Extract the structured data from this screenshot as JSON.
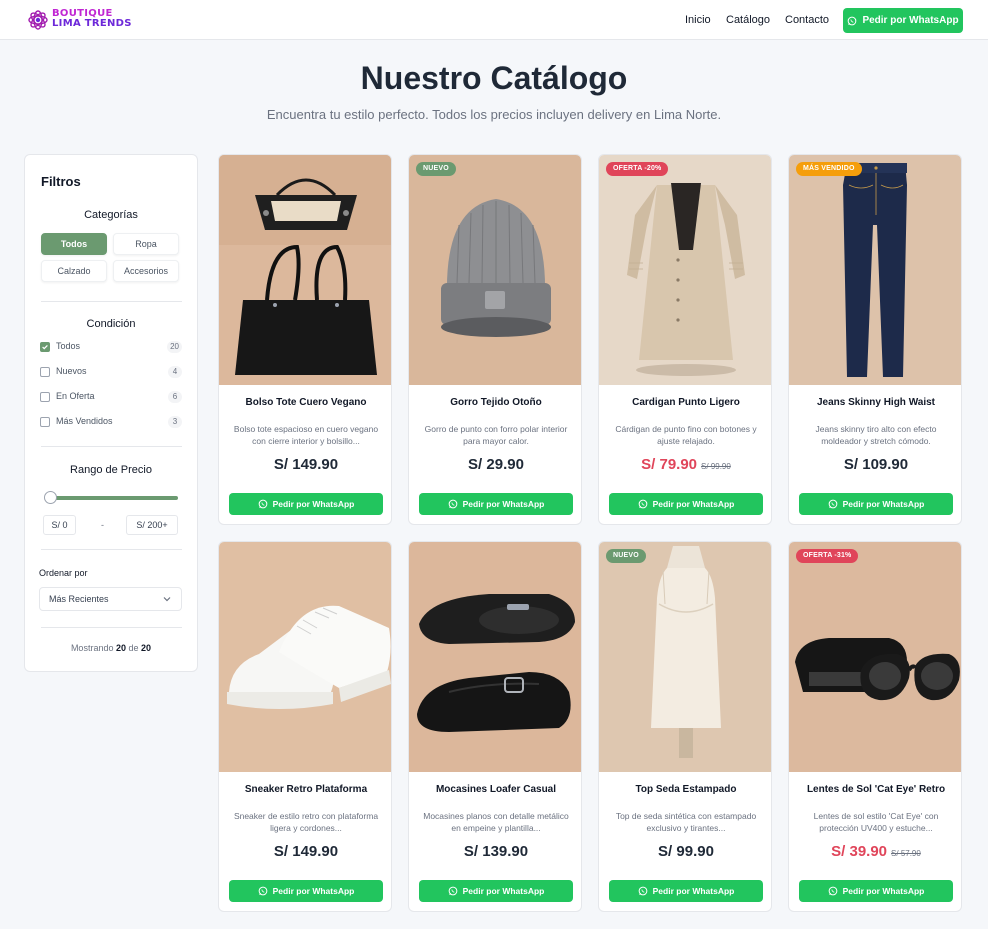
{
  "brand": {
    "line1": "BOUTIQUE",
    "line2": "LIMA TRENDS"
  },
  "nav": {
    "links": [
      "Inicio",
      "Catálogo",
      "Contacto"
    ],
    "whatsapp_label": "Pedir por WhatsApp"
  },
  "hero": {
    "title": "Nuestro Catálogo",
    "subtitle": "Encuentra tu estilo perfecto. Todos los precios incluyen delivery en Lima Norte."
  },
  "filters": {
    "title": "Filtros",
    "categories_title": "Categorías",
    "categories": [
      "Todos",
      "Ropa",
      "Calzado",
      "Accesorios"
    ],
    "active_category": "Todos",
    "condition_title": "Condición",
    "conditions": [
      {
        "label": "Todos",
        "count": "20",
        "checked": true
      },
      {
        "label": "Nuevos",
        "count": "4",
        "checked": false
      },
      {
        "label": "En Oferta",
        "count": "6",
        "checked": false
      },
      {
        "label": "Más Vendidos",
        "count": "3",
        "checked": false
      }
    ],
    "price_title": "Rango de Precio",
    "price_min": "S/ 0",
    "price_sep": "-",
    "price_max": "S/ 200+",
    "sort_label": "Ordenar por",
    "sort_value": "Más Recientes",
    "showing_prefix": "Mostrando",
    "showing_count": "20",
    "showing_mid": "de",
    "showing_total": "20"
  },
  "products": [
    {
      "name": "Bolso Tote Cuero Vegano",
      "desc": "Bolso tote espacioso en cuero vegano con cierre interior y bolsillo...",
      "price": "S/ 149.90",
      "old_price": "",
      "badge": "",
      "button": "Pedir por WhatsApp"
    },
    {
      "name": "Gorro Tejido Otoño",
      "desc": "Gorro de punto con forro polar interior para mayor calor.",
      "price": "S/ 29.90",
      "old_price": "",
      "badge": "NUEVO",
      "button": "Pedir por WhatsApp"
    },
    {
      "name": "Cardigan Punto Ligero",
      "desc": "Cárdigan de punto fino con botones y ajuste relajado.",
      "price": "S/ 79.90",
      "old_price": "S/ 99.90",
      "badge": "OFERTA -20%",
      "button": "Pedir por WhatsApp"
    },
    {
      "name": "Jeans Skinny High Waist",
      "desc": "Jeans skinny tiro alto con efecto moldeador y stretch cómodo.",
      "price": "S/ 109.90",
      "old_price": "",
      "badge": "MÁS VENDIDO",
      "button": "Pedir por WhatsApp"
    },
    {
      "name": "Sneaker Retro Plataforma",
      "desc": "Sneaker de estilo retro con plataforma ligera y cordones...",
      "price": "S/ 149.90",
      "old_price": "",
      "badge": "",
      "button": "Pedir por WhatsApp"
    },
    {
      "name": "Mocasines Loafer Casual",
      "desc": "Mocasines planos con detalle metálico en empeine y plantilla...",
      "price": "S/ 139.90",
      "old_price": "",
      "badge": "",
      "button": "Pedir por WhatsApp"
    },
    {
      "name": "Top Seda Estampado",
      "desc": "Top de seda sintética con estampado exclusivo y tirantes...",
      "price": "S/ 99.90",
      "old_price": "",
      "badge": "NUEVO",
      "button": "Pedir por WhatsApp"
    },
    {
      "name": "Lentes de Sol 'Cat Eye' Retro",
      "desc": "Lentes de sol estilo 'Cat Eye' con protección UV400 y estuche...",
      "price": "S/ 39.90",
      "old_price": "S/ 57.90",
      "badge": "OFERTA -31%",
      "button": "Pedir por WhatsApp"
    }
  ],
  "colors": {
    "whatsapp_green": "#22c55e",
    "filter_active": "#6b9a70",
    "sale_red": "#e0455a",
    "badge_new": "#6b9a70",
    "badge_offer": "#e0455a",
    "badge_bestseller": "#f59e0b"
  },
  "icons": [
    "whatsapp-icon",
    "checkbox-check-icon",
    "chevron-down-icon"
  ]
}
